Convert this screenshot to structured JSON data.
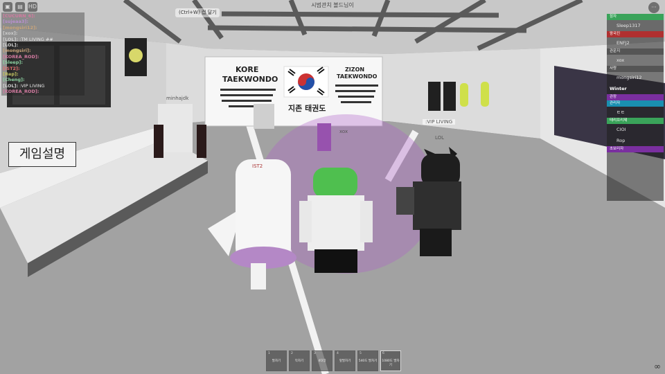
{
  "place_title": "시범관치 볼드님이",
  "chat_hint": "(Ctrl+W) 캡 달기",
  "top_icons": [
    "roblox-menu-icon",
    "chat-icon",
    "hd-icon"
  ],
  "top_icon_text": {
    "hd": "HD"
  },
  "chat": [
    {
      "name": "[CUCURN_6]:",
      "text": "",
      "color": "#d37aa0"
    },
    {
      "name": "[sujeaa3]:",
      "text": "",
      "color": "#b98fd0"
    },
    {
      "name": "[mongsiri12]:",
      "text": "",
      "color": "#c9a47a"
    },
    {
      "name": "[xox]:",
      "text": "",
      "color": "#cccccc"
    },
    {
      "name": "[LOL]:",
      "text": ":TM LIVING ##",
      "color": "#cfcfcf"
    },
    {
      "name": "[LOL]:",
      "text": "",
      "color": "#cfcfcf"
    },
    {
      "name": "[mongsiri]:",
      "text": "",
      "color": "#c9a47a"
    },
    {
      "name": "[KOREA_ROD]:",
      "text": "",
      "color": "#d37aa0"
    },
    {
      "name": "[Sleep]:",
      "text": "",
      "color": "#8bd0a0"
    },
    {
      "name": "[IST2]:",
      "text": "",
      "color": "#e07070"
    },
    {
      "name": "[Rep]:",
      "text": "",
      "color": "#c0c060"
    },
    {
      "name": "[Cheng]:",
      "text": "",
      "color": "#8bd0a0"
    },
    {
      "name": "[LOL]:",
      "text": ":VIP LIVING",
      "color": "#cfcfcf"
    },
    {
      "name": "[KOREA_ROD]:",
      "text": "",
      "color": "#d37aa0"
    }
  ],
  "game_desc": "게임설명",
  "banner": {
    "left_title_1": "KORE",
    "left_title_2": "TAEKWONDO",
    "right_title_1": "ZIZON",
    "right_title_2": "TAEKWONDO",
    "center_text": "지존 태권도"
  },
  "nametags": {
    "vip": ":VIP LIVING",
    "lol": "LOL",
    "xox": "xox",
    "ist": "IST2",
    "minha": "minhajdk"
  },
  "player_list": [
    {
      "type": "team",
      "label": "잠자",
      "color": "#3aa35a"
    },
    {
      "type": "row",
      "label": "Sleep1317"
    },
    {
      "type": "team",
      "label": "왕국진",
      "color": "#b03030"
    },
    {
      "type": "row",
      "label": "ENFJ2"
    },
    {
      "type": "team",
      "label": "관운지",
      "color": "#555555"
    },
    {
      "type": "row",
      "label": "xox"
    },
    {
      "type": "team",
      "label": "사랑",
      "color": "#555555"
    },
    {
      "type": "row",
      "label": "mongsiri12"
    },
    {
      "type": "bold",
      "label": "Winter"
    },
    {
      "type": "team",
      "label": "관장",
      "color": "#7a2fa0"
    },
    {
      "type": "team",
      "label": "관리자",
      "color": "#1a8fb0"
    },
    {
      "type": "row",
      "label": "ㅌㅌ"
    },
    {
      "type": "team",
      "label": "태리프리제",
      "color": "#3aa35a"
    },
    {
      "type": "row",
      "label": "CIOI"
    },
    {
      "type": "row",
      "label": "Rop"
    },
    {
      "type": "team",
      "label": "초보리자",
      "color": "#7a2fa0"
    }
  ],
  "hotbar": [
    {
      "num": "1",
      "label": "발차기"
    },
    {
      "num": "2",
      "label": "막차기"
    },
    {
      "num": "3",
      "label": "4대장"
    },
    {
      "num": "4",
      "label": "앞발차기"
    },
    {
      "num": "5",
      "label": "540도 발차기"
    },
    {
      "num": "6",
      "label": "1080도 발차기"
    }
  ],
  "hotbar_selected": 5,
  "bottom_icon": "∞",
  "more_icon": "···"
}
